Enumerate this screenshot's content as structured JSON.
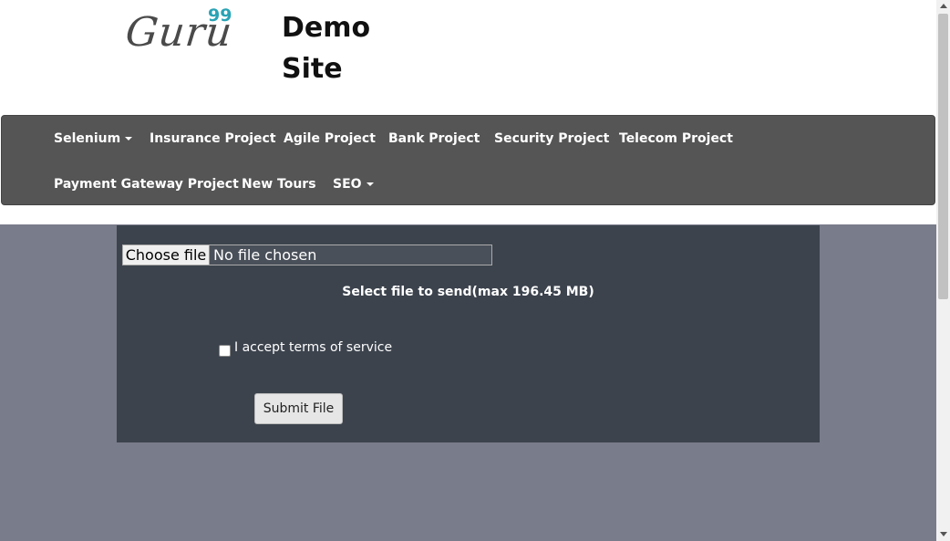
{
  "header": {
    "logo_text": "Guru",
    "logo_sup": "99",
    "site_title": "Demo Site"
  },
  "nav": {
    "items": [
      {
        "label": "Selenium",
        "dropdown": true
      },
      {
        "label": "Insurance Project",
        "dropdown": false
      },
      {
        "label": "Agile Project",
        "dropdown": false
      },
      {
        "label": "Bank Project",
        "dropdown": false
      },
      {
        "label": "Security Project",
        "dropdown": false
      },
      {
        "label": "Telecom Project",
        "dropdown": false
      },
      {
        "label": "Payment Gateway Project",
        "dropdown": false
      },
      {
        "label": "New Tours",
        "dropdown": false
      },
      {
        "label": "SEO",
        "dropdown": true
      }
    ]
  },
  "upload": {
    "choose_button": "Choose file",
    "file_status": "No file chosen",
    "hint": "Select file to send(max 196.45 MB)",
    "terms_label": "I accept terms of service",
    "terms_checked": false,
    "submit_label": "Submit File"
  },
  "colors": {
    "nav_bg": "#555555",
    "page_bg": "#797c8a",
    "panel_bg": "#3c434d",
    "logo_accent": "#2aa3b5"
  }
}
